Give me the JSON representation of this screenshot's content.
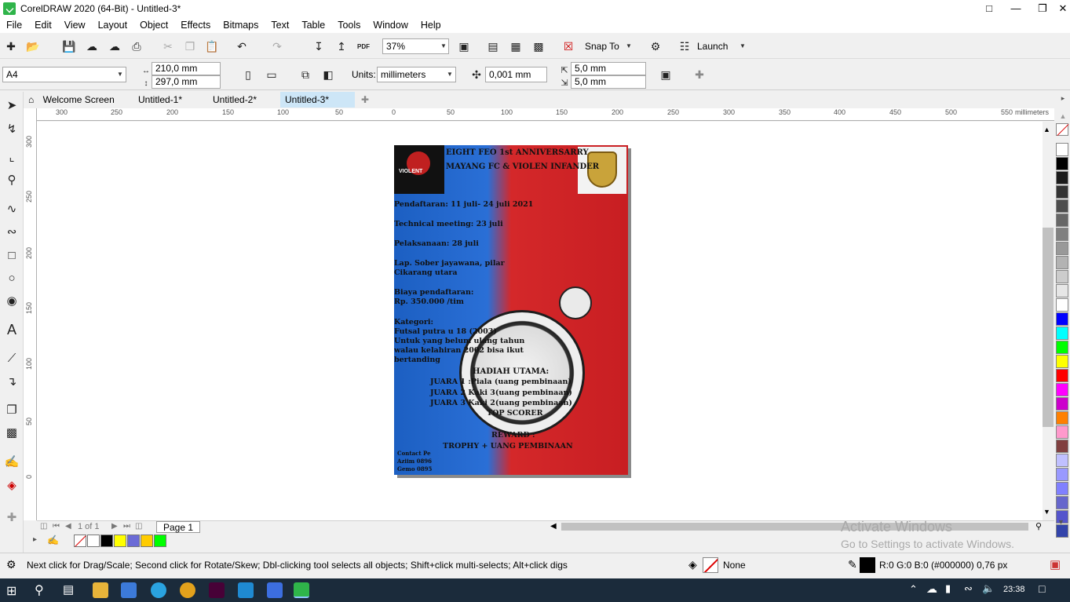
{
  "window": {
    "title": "CorelDRAW 2020 (64-Bit) - Untitled-3*"
  },
  "menu": [
    "File",
    "Edit",
    "View",
    "Layout",
    "Object",
    "Effects",
    "Bitmaps",
    "Text",
    "Table",
    "Tools",
    "Window",
    "Help"
  ],
  "toolbar1": {
    "zoom": "37%",
    "snap_to": "Snap To",
    "launch": "Launch",
    "pdf": "PDF"
  },
  "toolbar2": {
    "page_size": "A4",
    "width": "210,0 mm",
    "height": "297,0 mm",
    "units_label": "Units:",
    "units": "millimeters",
    "nudge": "0,001 mm",
    "dup_x": "5,0 mm",
    "dup_y": "5,0 mm"
  },
  "tabs": [
    "Welcome Screen",
    "Untitled-1*",
    "Untitled-2*",
    "Untitled-3*"
  ],
  "ruler": {
    "h_labels": [
      "300",
      "250",
      "200",
      "150",
      "100",
      "50",
      "0",
      "50",
      "100",
      "150",
      "200",
      "250",
      "300",
      "350",
      "400",
      "450",
      "500",
      "550"
    ],
    "unit": "millimeters",
    "v_labels": [
      "300",
      "250",
      "200",
      "150",
      "100",
      "50",
      "0"
    ]
  },
  "poster": {
    "title1": "EIGHT FEO 1st ANNIVERSARRY",
    "title2": "MAYANG FC & VIOLEN INFANDER",
    "logo_left": "VIOLENT",
    "lines": [
      "Pendaftaran: 11 juli- 24 juli 2021",
      "Technical meeting: 23 juli",
      "Pelaksanaan: 28 juli",
      "Lap. Sober jayawana, pilar",
      "Cikarang utara",
      "Biaya pendaftaran:",
      "Rp. 350.000 /tim",
      "Kategori:",
      "Futsal putra u 18 (2003)",
      "Untuk yang belum ulang tahun",
      "walau kelahiran 2002 bisa ikut",
      "bertanding"
    ],
    "prize_title": "HADIAH UTAMA:",
    "prizes": [
      "JUARA 1 :Piala (uang pembinaan)",
      "JUARA 2 Kaki 3(uang pembinaan)",
      "JUARA 3 Kaki 2(uang pembinaan)",
      "TOP SCORER"
    ],
    "reward_title": "REWARD :",
    "reward": "TROPHY + UANG PEMBINAAN",
    "contact": [
      "Contact Pe",
      "Aziim 0896",
      "Gemo 0895"
    ]
  },
  "pagenav": {
    "counter": "1 of 1",
    "page_tab": "Page 1"
  },
  "status": {
    "hint": "Next click for Drag/Scale; Second click for Rotate/Skew; Dbl-clicking tool selects all objects; Shift+click multi-selects; Alt+click digs",
    "fill": "None",
    "outline": "R:0 G:0 B:0 (#000000)  0,76 px"
  },
  "watermark": {
    "line1": "Activate Windows",
    "line2": "Go to Settings to activate Windows."
  },
  "taskbar": {
    "time": "23:38"
  },
  "colors": {
    "palette": [
      "#ffffff",
      "#000000",
      "#1a1a1a",
      "#333333",
      "#4d4d4d",
      "#666666",
      "#808080",
      "#999999",
      "#b3b3b3",
      "#cccccc",
      "#e6e6e6",
      "#ffffff",
      "#0000ff",
      "#00ffff",
      "#00ff00",
      "#ffff00",
      "#ff0000",
      "#ff00ff",
      "#cc00cc",
      "#ff8000",
      "#ff99cc",
      "#804040",
      "#c0c0ff",
      "#9999ff",
      "#8080ff",
      "#6666cc",
      "#5555cc",
      "#3344aa"
    ],
    "docker": [
      "#ffffff",
      "#000000",
      "#ffff00",
      "#6b6bd6",
      "#ffcc00",
      "#00ff00"
    ]
  }
}
